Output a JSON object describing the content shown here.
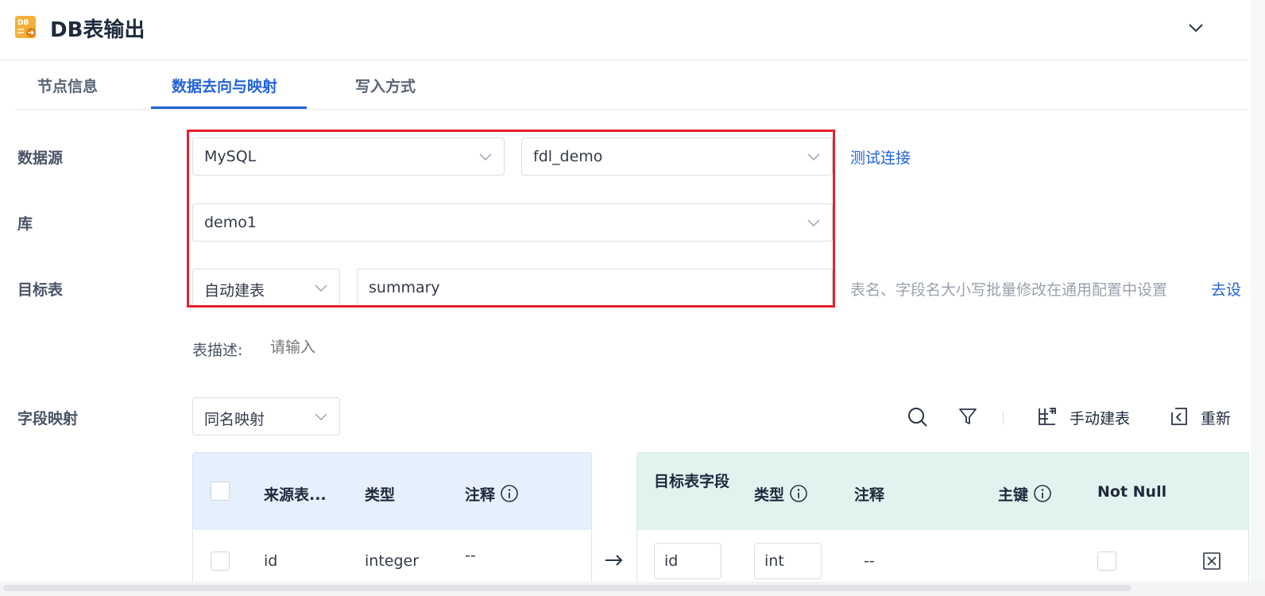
{
  "header": {
    "ellipsis": "···",
    "title": "DB表输出"
  },
  "tabs": [
    {
      "label": "节点信息"
    },
    {
      "label": "数据去向与映射"
    },
    {
      "label": "写入方式"
    }
  ],
  "datasource": {
    "label": "数据源",
    "type_value": "MySQL",
    "connection_value": "fdl_demo",
    "test_link": "测试连接"
  },
  "database": {
    "label": "库",
    "value": "demo1"
  },
  "target_table": {
    "label": "目标表",
    "mode_value": "自动建表",
    "table_value": "summary",
    "hint": "表名、字段名大小写批量修改在通用配置中设置",
    "settings_link": "去设"
  },
  "table_desc": {
    "label": "表描述:",
    "placeholder": "请输入"
  },
  "field_mapping": {
    "label": "字段映射",
    "mode_value": "同名映射",
    "manual_create_label": "手动建表",
    "remap_label": "重新"
  },
  "source_table": {
    "headers": [
      "来源表...",
      "类型",
      "注释"
    ],
    "rows": [
      {
        "field": "id",
        "type": "integer",
        "comment": "--"
      }
    ]
  },
  "target_columns": {
    "headers": [
      "目标表字段",
      "类型",
      "注释",
      "主键",
      "Not Null"
    ],
    "rows": [
      {
        "field": "id",
        "type": "int",
        "comment": "--"
      }
    ]
  }
}
